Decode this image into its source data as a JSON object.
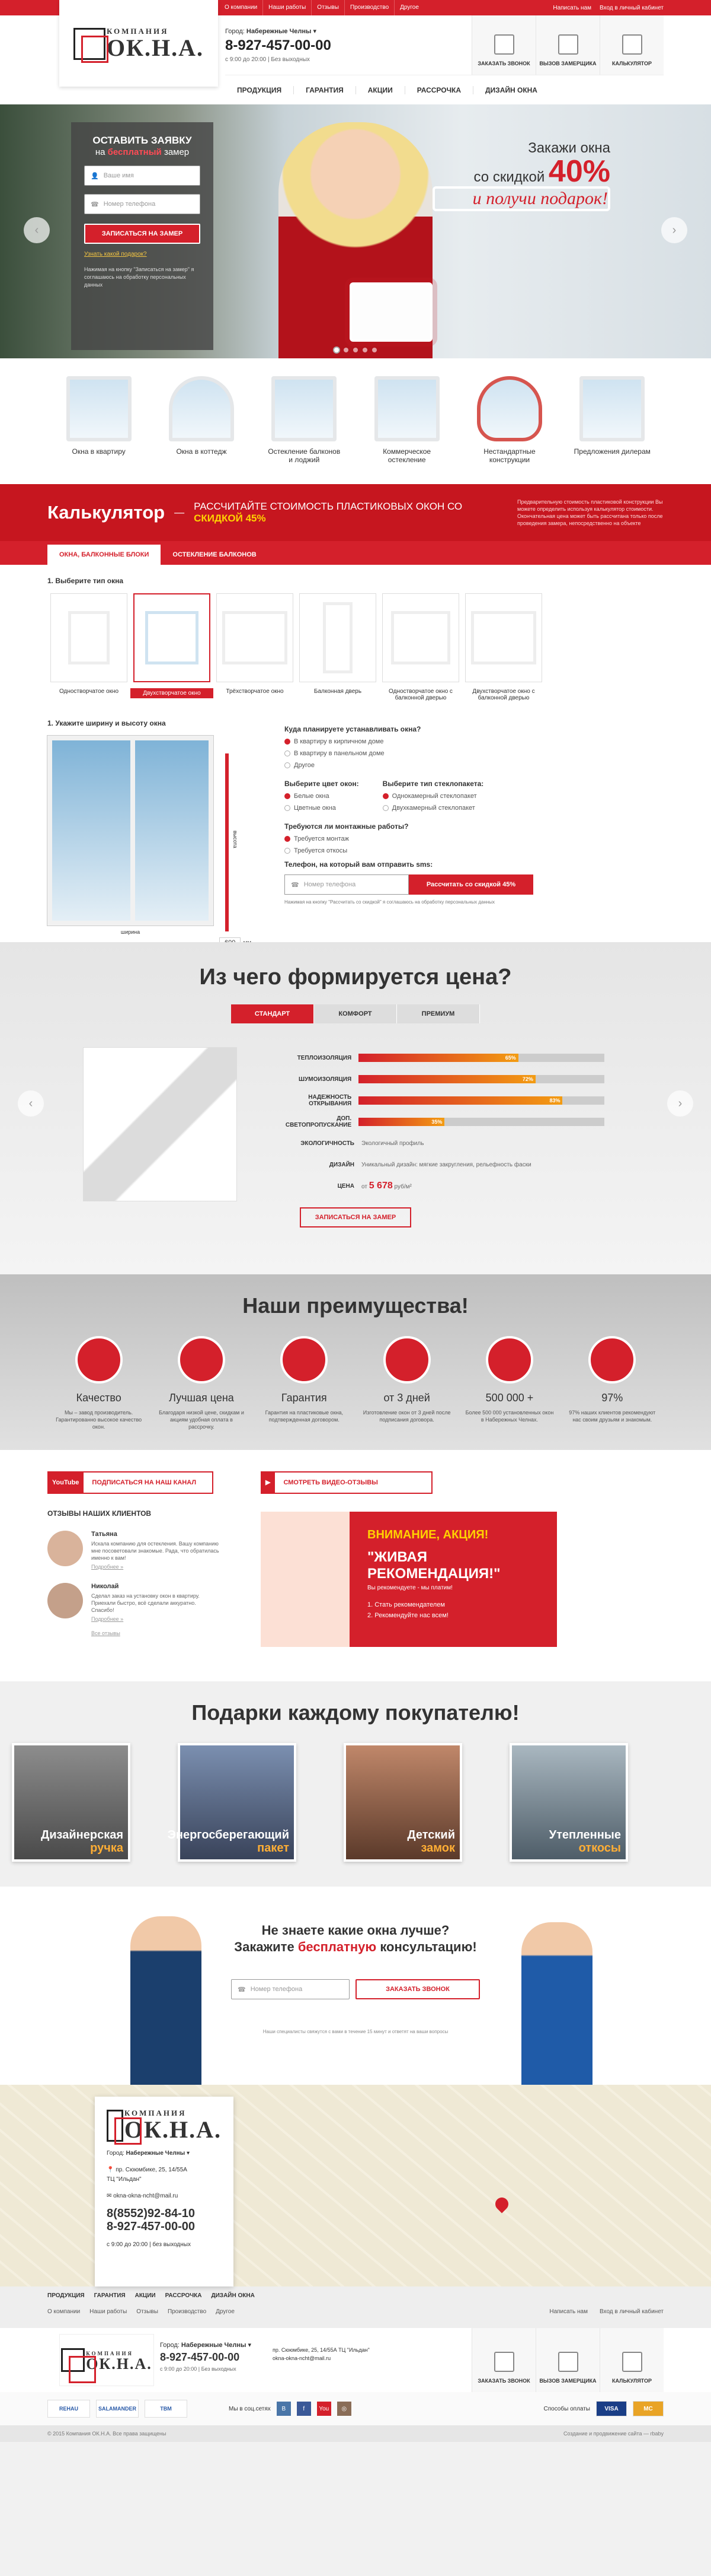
{
  "topbar": {
    "links": [
      "О компании",
      "Наши работы",
      "Отзывы",
      "Производство",
      "Другое"
    ],
    "callback": "Написать нам",
    "cabinet": "Вход в личный кабинет"
  },
  "logo": {
    "small": "КОМПАНИЯ",
    "big": "ОК.Н.А."
  },
  "header": {
    "city_label": "Город:",
    "city": "Набережные Челны",
    "phone": "8-927-457-00-00",
    "hours": "с 9:00 до 20:00 | Без выходных",
    "buttons": [
      "ЗАКАЗАТЬ ЗВОНОК",
      "ВЫЗОВ ЗАМЕРЩИКА",
      "КАЛЬКУЛЯТОР"
    ]
  },
  "nav": [
    "ПРОДУКЦИЯ",
    "ГАРАНТИЯ",
    "АКЦИИ",
    "РАССРОЧКА",
    "ДИЗАЙН ОКНА"
  ],
  "hero": {
    "form_title": "ОСТАВИТЬ ЗАЯВКУ",
    "form_sub_pre": "на",
    "form_sub_bold": "бесплатный",
    "form_sub_post": "замер",
    "name_placeholder": "Ваше имя",
    "phone_placeholder": "Номер телефона",
    "submit": "ЗАПИСАТЬСЯ НА ЗАМЕР",
    "gift_link": "Узнать какой подарок?",
    "note": "Нажимая на кнопку \"Записаться на замер\" я соглашаюсь на обработку персональных данных",
    "promo_l1": "Закажи окна",
    "promo_l2": "со скидкой",
    "promo_pct": "40%",
    "promo_gift": "и получи подарок!"
  },
  "types": [
    {
      "label": "Окна в квартиру"
    },
    {
      "label": "Окна в коттедж"
    },
    {
      "label": "Остекление балконов и лоджий"
    },
    {
      "label": "Коммерческое остекление"
    },
    {
      "label": "Нестандартные конструкции"
    },
    {
      "label": "Предложения дилерам"
    }
  ],
  "calc": {
    "title": "Калькулятор",
    "dash": "—",
    "sub": "РАССЧИТАЙТЕ СТОИМОСТЬ ПЛАСТИКОВЫХ ОКОН СО",
    "sub_bold": "СКИДКОЙ 45%",
    "desc": "Предварительную стоимость пластиковой конструкции Вы можете определить используя калькулятор стоимости. Окончательная цена может быть рассчитана только после проведения замера, непосредственно на объекте",
    "tabs": [
      "ОКНА, БАЛКОННЫЕ БЛОКИ",
      "ОСТЕКЛЕНИЕ БАЛКОНОВ"
    ],
    "step1": "1. Выберите тип окна",
    "windows": [
      "Одностворчатое окно",
      "Двухстворчатое окно",
      "Трёхстворчатое окно",
      "Балконная дверь",
      "Одностворчатое окно с балконной дверью",
      "Двухстворчатое окно с балконной дверью"
    ],
    "step2": "1. Укажите ширину и высоту окна",
    "height_label": "высота",
    "width_label": "ширина",
    "height_val": "600",
    "width_val": "600",
    "unit": "мм",
    "q_where": "Куда планируете устанавливать окна?",
    "where": [
      "В квартиру в кирпичном доме",
      "В квартиру в панельном доме",
      "Другое"
    ],
    "q_color": "Выберите цвет окон:",
    "colors": [
      "Белые окна",
      "Цветные окна"
    ],
    "q_glass": "Выберите тип стеклопакета:",
    "glass": [
      "Однокамерный стеклопакет",
      "Двухкамерный стеклопакет"
    ],
    "q_mount": "Требуются ли монтажные работы?",
    "mount": [
      "Требуется монтаж",
      "Требуется откосы"
    ],
    "q_phone": "Телефон, на который вам отправить sms:",
    "phone_placeholder": "Номер телефона",
    "submit": "Рассчитать со скидкой 45%",
    "consent": "Нажимая на кнопку \"Рассчитать со скидкой\" я соглашаюсь на обработку персональных данных"
  },
  "price": {
    "title": "Из чего формируется цена?",
    "tabs": [
      "СТАНДАРТ",
      "КОМФОРТ",
      "ПРЕМИУМ"
    ],
    "bars": [
      {
        "label": "ТЕПЛОИЗОЛЯЦИЯ",
        "value": 65
      },
      {
        "label": "ШУМОИЗОЛЯЦИЯ",
        "value": 72
      },
      {
        "label": "НАДЕЖНОСТЬ ОТКРЫВАНИЯ",
        "value": 83
      },
      {
        "label": "ДОП. СВЕТОПРОПУСКАНИЕ",
        "value": 35
      }
    ],
    "eco_label": "ЭКОЛОГИЧНОСТЬ",
    "eco_val": "Экологичный профиль",
    "design_label": "ДИЗАЙН",
    "design_val": "Уникальный дизайн: мягкие закругления, рельефность фаски",
    "price_label": "ЦЕНА",
    "price_from": "от",
    "price_val": "5 678",
    "price_unit": "руб/м²",
    "button": "ЗАПИСАТЬСЯ НА ЗАМЕР",
    "colors": {
      "fill_start": "#d4202b",
      "fill_end": "#f39c12"
    }
  },
  "advantages": {
    "title": "Наши преимущества!",
    "items": [
      {
        "title": "Качество",
        "text": "Мы – завод производитель. Гарантированно высокое качество окон."
      },
      {
        "title": "Лучшая цена",
        "text": "Благодаря низкой цене, скидкам и акциям удобная оплата в рассрочку."
      },
      {
        "title": "Гарантия",
        "text": "Гарантия на пластиковые окна, подтвержденная договором."
      },
      {
        "title": "от 3 дней",
        "text": "Изготовление окон от 3 дней после подписания договора."
      },
      {
        "title": "500 000 +",
        "text": "Более 500 000 установленных окон в Набережных Челнах."
      },
      {
        "title": "97%",
        "text": "97% наших клиентов рекомендуют нас своим друзьям и знакомым."
      }
    ]
  },
  "reviews": {
    "yt1": "ПОДПИСАТЬСЯ НА НАШ КАНАЛ",
    "yt2": "СМОТРЕТЬ ВИДЕО-ОТЗЫВЫ",
    "yt_logo": "YouTube",
    "title": "ОТЗЫВЫ НАШИХ КЛИЕНТОВ",
    "items": [
      {
        "name": "Татьяна",
        "text": "Искала компанию для остекления. Вашу компанию мне посоветовали знакомые. Рада, что обратилась именно к вам!",
        "more": "Подробнее »"
      },
      {
        "name": "Николай",
        "text": "Сделал заказ на установку окон в квартиру. Приехали быстро, всё сделали аккуратно. Спасибо!",
        "more": "Подробнее »"
      }
    ],
    "all": "Все отзывы",
    "banner_t1": "ВНИМАНИЕ, АКЦИЯ!",
    "banner_t2": "\"ЖИВАЯ РЕКОМЕНДАЦИЯ!\"",
    "banner_t3": "Вы рекомендуете - мы платим!",
    "banner_s1": "1. Стать рекомендателем",
    "banner_s2": "2. Рекомендуйте нас всем!"
  },
  "gifts": {
    "title": "Подарки каждому покупателю!",
    "items": [
      {
        "l1": "Дизайнерская",
        "l2": "ручка"
      },
      {
        "l1": "Энергосберегающий",
        "l2": "пакет"
      },
      {
        "l1": "Детский",
        "l2": "замок"
      },
      {
        "l1": "Утепленные",
        "l2": "откосы"
      }
    ]
  },
  "consult": {
    "l1": "Не знаете какие окна лучше?",
    "l2_pre": "Закажите",
    "l2_bold": "бесплатную",
    "l2_post": "консультацию!",
    "placeholder": "Номер телефона",
    "button": "ЗАКАЗАТЬ ЗВОНОК",
    "small": "Наши специалисты свяжутся с вами в течение 15 минут и ответят на ваши вопросы"
  },
  "map": {
    "city_label": "Город:",
    "city": "Набережные Челны",
    "addr1": "пр. Сююмбике, 25, 14/55А",
    "addr2": "ТЦ \"Ильдан\"",
    "email": "okna-okna-ncht@mail.ru",
    "phone1": "8(8552)92-84-10",
    "phone2": "8-927-457-00-00",
    "hours": "с 9:00 до 20:00 | без выходных"
  },
  "footer": {
    "nav": [
      "ПРОДУКЦИЯ",
      "ГАРАНТИЯ",
      "АКЦИИ",
      "РАССРОЧКА",
      "ДИЗАЙН ОКНА"
    ],
    "nav2": [
      "О компании",
      "Наши работы",
      "Отзывы",
      "Производство",
      "Другое"
    ],
    "write": "Написать нам",
    "cabinet": "Вход в личный кабинет",
    "phone": "8-927-457-00-00",
    "hours": "с 9:00 до 20:00 | Без выходных",
    "addr": "пр. Сююмбике, 25, 14/55А ТЦ \"Ильдан\"",
    "email": "okna-okna-ncht@mail.ru",
    "partners": [
      "REHAU",
      "SALAMANDER",
      "TBM"
    ],
    "social_label": "Мы в соц.сетях",
    "social": [
      "В",
      "f",
      "You",
      "◎"
    ],
    "pay_label": "Способы оплаты",
    "pay": [
      "VISA",
      "MC"
    ],
    "copyright": "© 2015 Компания ОК.Н.А. Все права защищены",
    "dev": "Создание и продвижение сайта — rbaby"
  }
}
